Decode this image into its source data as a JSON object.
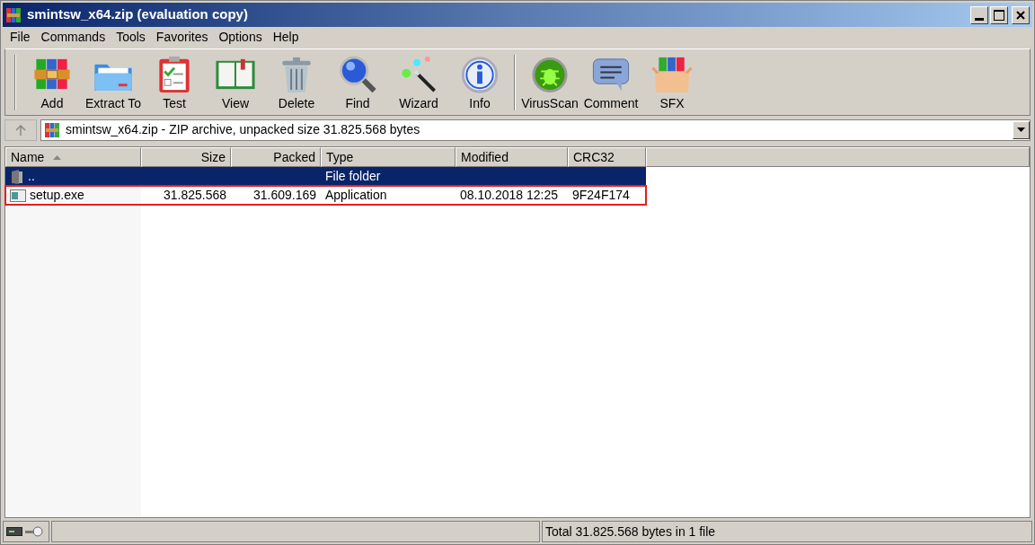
{
  "window": {
    "title": "smintsw_x64.zip (evaluation copy)"
  },
  "menu": [
    "File",
    "Commands",
    "Tools",
    "Favorites",
    "Options",
    "Help"
  ],
  "toolbar_groups": [
    [
      {
        "label": "Add",
        "kind": "books"
      },
      {
        "label": "Extract To",
        "kind": "folder"
      },
      {
        "label": "Test",
        "kind": "clipboard"
      },
      {
        "label": "View",
        "kind": "book"
      },
      {
        "label": "Delete",
        "kind": "trash"
      },
      {
        "label": "Find",
        "kind": "magnifier"
      },
      {
        "label": "Wizard",
        "kind": "wand"
      },
      {
        "label": "Info",
        "kind": "info"
      }
    ],
    [
      {
        "label": "VirusScan",
        "kind": "bug"
      },
      {
        "label": "Comment",
        "kind": "speech"
      },
      {
        "label": "SFX",
        "kind": "box"
      }
    ]
  ],
  "address": {
    "path": "smintsw_x64.zip - ZIP archive, unpacked size 31.825.568 bytes"
  },
  "table": {
    "columns": [
      {
        "label": "Name",
        "sorted": true
      },
      {
        "label": "Size",
        "sorted": false
      },
      {
        "label": "Packed",
        "sorted": false
      },
      {
        "label": "Type",
        "sorted": false
      },
      {
        "label": "Modified",
        "sorted": false
      },
      {
        "label": "CRC32",
        "sorted": false
      }
    ],
    "rows": [
      {
        "kind": "folder",
        "cells": [
          "..",
          "",
          "",
          "File folder",
          "",
          ""
        ],
        "selected": true,
        "outlined": false
      },
      {
        "kind": "exe",
        "cells": [
          "setup.exe",
          "31.825.568",
          "31.609.169",
          "Application",
          "08.10.2018 12:25",
          "9F24F174"
        ],
        "selected": false,
        "outlined": true
      }
    ]
  },
  "status_bar": {
    "total": "Total 31.825.568 bytes in 1 file"
  }
}
